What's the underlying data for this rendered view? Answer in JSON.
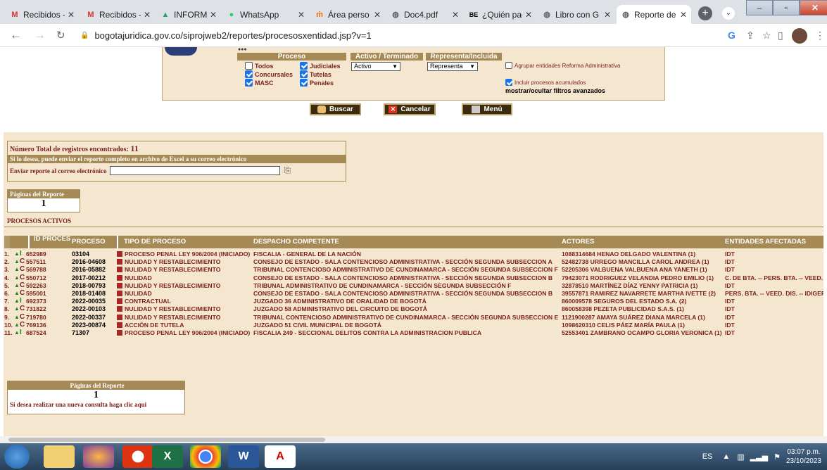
{
  "browser": {
    "tabs": [
      {
        "label": "Recibidos -",
        "icon": "gmail-icon",
        "active": false
      },
      {
        "label": "Recibidos -",
        "icon": "gmail-icon",
        "active": false
      },
      {
        "label": "INFORMAC",
        "icon": "google-drive-icon",
        "active": false
      },
      {
        "label": "WhatsApp",
        "icon": "whatsapp-icon",
        "active": false
      },
      {
        "label": "Área perso",
        "icon": "web-icon",
        "active": false
      },
      {
        "label": "Doc4.pdf",
        "icon": "globe-icon",
        "active": false
      },
      {
        "label": "¿Quién pag",
        "icon": "be-icon",
        "active": false
      },
      {
        "label": "Libro con G",
        "icon": "globe-icon",
        "active": false
      },
      {
        "label": "Reporte de",
        "icon": "globe-icon",
        "active": true
      }
    ],
    "favicon_text": {
      "be": "BE"
    },
    "url": "bogotajuridica.gov.co/siprojweb2/reportes/procesosxentidad.jsp?v=1"
  },
  "filters": {
    "proceso_header": "Proceso",
    "activo_header": "Activo / Terminado",
    "representa_header": "Representa/Incluida",
    "checks": {
      "todos": {
        "label": "Todos",
        "checked": false
      },
      "judiciales": {
        "label": "Judiciales",
        "checked": true
      },
      "concursales": {
        "label": "Concursales",
        "checked": true
      },
      "tutelas": {
        "label": "Tutelas",
        "checked": true
      },
      "masc": {
        "label": "MASC",
        "checked": true
      },
      "penales": {
        "label": "Penales",
        "checked": true
      }
    },
    "activo_value": "Activo",
    "representa_value": "Representa",
    "agrupar_label": "Agrupar entidades Reforma Administrativa",
    "incluir_label": "Incluir procesos acumulados",
    "advanced_link": "mostrar/ocultar filtros avanzados"
  },
  "actions": {
    "buscar": "Buscar",
    "cancelar": "Cancelar",
    "menu": "Menú"
  },
  "summary": {
    "total_label": "Número Total de registros encontrados:",
    "total_value": "11",
    "excel_msg": "Si lo desea, puede enviar el reporte completo en archivo de Excel a su correo electrónico",
    "email_label": "Enviar reporte al correo electrónico",
    "email_value": ""
  },
  "pages_top": {
    "title": "Páginas del Reporte",
    "value": "1"
  },
  "section_title": "PROCESOS ACTIVOS",
  "table": {
    "headers": {
      "id": "ID PROCESO",
      "proceso": "PROCESO",
      "tipo": "TIPO DE PROCESO",
      "despacho": "DESPACHO COMPETENTE",
      "actores": "ACTORES",
      "entidades": "ENTIDADES AFECTADAS"
    },
    "rows": [
      {
        "n": "1.",
        "mark": "I",
        "id": "652989",
        "proceso": "03104",
        "tipo": "PROCESO PENAL LEY 906/2004 (INICIADO)",
        "despacho": "FISCALIA - GENERAL DE LA NACIÓN",
        "actores": "1088314684 HENAO DELGADO VALENTINA (1)",
        "entidades": "IDT"
      },
      {
        "n": "2.",
        "mark": "C",
        "id": "557511",
        "proceso": "2016-04608",
        "tipo": "NULIDAD Y RESTABLECIMIENTO",
        "despacho": "CONSEJO DE ESTADO - SALA CONTENCIOSO ADMINISTRATIVA - SECCIÓN SEGUNDA SUBSECCION A",
        "actores": "52482738 URREGO MANCILLA CAROL ANDREA (1)",
        "entidades": "IDT"
      },
      {
        "n": "3.",
        "mark": "C",
        "id": "569788",
        "proceso": "2016-05882",
        "tipo": "NULIDAD Y RESTABLECIMIENTO",
        "despacho": "TRIBUNAL CONTENCIOSO ADMINISTRATIVO DE CUNDINAMARCA - SECCIÓN SEGUNDA SUBSECCION F",
        "actores": "52205306 VALBUENA VALBUENA ANA YANETH (1)",
        "entidades": "IDT"
      },
      {
        "n": "4.",
        "mark": "C",
        "id": "550712",
        "proceso": "2017-00212",
        "tipo": "NULIDAD",
        "despacho": "CONSEJO DE ESTADO - SALA CONTENCIOSO ADMINISTRATIVA - SECCIÓN SEGUNDA SUBSECCION B",
        "actores": "79423071 RODRIGUEZ VELANDIA PEDRO EMILIO (1)",
        "entidades": "C. DE BTA. -- PERS. BTA. -- VEED."
      },
      {
        "n": "5.",
        "mark": "C",
        "id": "592263",
        "proceso": "2018-00793",
        "tipo": "NULIDAD Y RESTABLECIMIENTO",
        "despacho": "TRIBUNAL ADMINISTRATIVO DE CUNDINAMARCA - SECCIÓN SEGUNDA SUBSECCIÓN F",
        "actores": "32878510 MARTÍNEZ DÍAZ YENNY PATRICIA (1)",
        "entidades": "IDT"
      },
      {
        "n": "6.",
        "mark": "C",
        "id": "595001",
        "proceso": "2018-01408",
        "tipo": "NULIDAD",
        "despacho": "CONSEJO DE ESTADO - SALA CONTENCIOSO ADMINISTRATIVA - SECCIÓN SEGUNDA SUBSECCION B",
        "actores": "39557871 RAMIREZ NAVARRETE MARTHA IVETTE (2)",
        "entidades": "PERS. BTA. -- VEED. DIS. -- IDIGEF"
      },
      {
        "n": "7.",
        "mark": "I",
        "id": "692373",
        "proceso": "2022-00035",
        "tipo": "CONTRACTUAL",
        "despacho": "JUZGADO 36 ADMINISTRATIVO DE ORALIDAD DE BOGOTÁ",
        "actores": "860009578 SEGUROS DEL ESTADO S.A. (2)",
        "entidades": "IDT"
      },
      {
        "n": "8.",
        "mark": "C",
        "id": "731822",
        "proceso": "2022-00103",
        "tipo": "NULIDAD Y RESTABLECIMIENTO",
        "despacho": "JUZGADO 58 ADMINISTRATIVO DEL CIRCUITO DE BOGOTÁ",
        "actores": "860058398 PEZETA PUBLICIDAD S.A.S. (1)",
        "entidades": "IDT"
      },
      {
        "n": "9.",
        "mark": "C",
        "id": "719780",
        "proceso": "2022-00337",
        "tipo": "NULIDAD Y RESTABLECIMIENTO",
        "despacho": "TRIBUNAL CONTENCIOSO ADMINISTRATIVO DE CUNDINAMARCA - SECCIÓN SEGUNDA SUBSECCION E",
        "actores": "1121900287 AMAYA SUÁREZ DIANA MARCELA (1)",
        "entidades": "IDT"
      },
      {
        "n": "10.",
        "mark": "C",
        "id": "769136",
        "proceso": "2023-00874",
        "tipo": "ACCIÓN DE TUTELA",
        "despacho": "JUZGADO 51 CIVIL MUNICIPAL DE BOGOTÁ",
        "actores": "1098620310 CELIS PÁEZ MARÍA PAULA (1)",
        "entidades": "IDT"
      },
      {
        "n": "11.",
        "mark": "I",
        "id": "687524",
        "proceso": "71307",
        "tipo": "PROCESO PENAL LEY 906/2004 (INICIADO)",
        "despacho": "FISCALIA 249 - SECCIONAL DELITOS CONTRA LA ADMINISTRACION PUBLICA",
        "actores": "52553401 ZAMBRANO OCAMPO GLORIA VERONICA (1)",
        "entidades": "IDT"
      }
    ]
  },
  "pages_bottom": {
    "title": "Páginas del Reporte",
    "value": "1",
    "new_query": "Si desea realizar una nueva consulta haga clic aqui"
  },
  "taskbar": {
    "lang": "ES",
    "time": "03:07 p.m.",
    "date": "23/10/2023"
  },
  "colors": {
    "panel_bg": "#f5e6cf",
    "header_bg": "#a58a55",
    "text_red": "#7a1e1e"
  }
}
